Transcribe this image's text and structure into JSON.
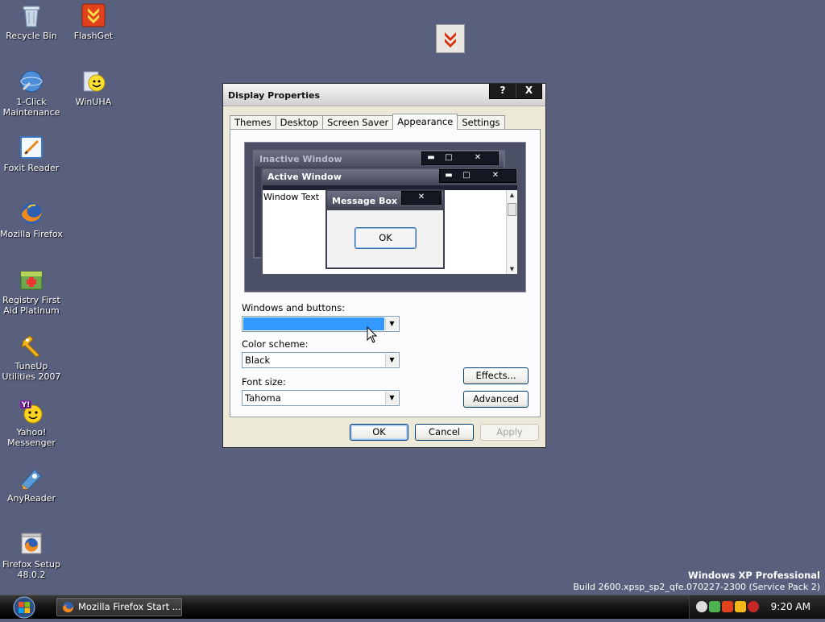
{
  "desktop": {
    "icons": [
      {
        "label": "Recycle Bin",
        "icon": "recycle-bin-icon"
      },
      {
        "label": "FlashGet",
        "icon": "flashget-icon"
      },
      {
        "label": "1-Click Maintenance",
        "icon": "maintenance-icon"
      },
      {
        "label": "WinUHA",
        "icon": "winuha-icon"
      },
      {
        "label": "Foxit Reader",
        "icon": "foxit-reader-icon"
      },
      {
        "label": "Mozilla Firefox",
        "icon": "firefox-icon"
      },
      {
        "label": "Registry First Aid Platinum",
        "icon": "registry-first-aid-icon"
      },
      {
        "label": "TuneUp Utilities 2007",
        "icon": "tuneup-icon"
      },
      {
        "label": "Yahoo! Messenger",
        "icon": "yahoo-messenger-icon"
      },
      {
        "label": "AnyReader",
        "icon": "anyreader-icon"
      },
      {
        "label": "Firefox Setup 48.0.2",
        "icon": "firefox-setup-icon"
      }
    ]
  },
  "dialog": {
    "title": "Display Properties",
    "help_button": "?",
    "close_button": "X",
    "tabs": [
      {
        "label": "Themes"
      },
      {
        "label": "Desktop"
      },
      {
        "label": "Screen Saver"
      },
      {
        "label": "Appearance",
        "active": true
      },
      {
        "label": "Settings"
      }
    ],
    "preview": {
      "inactive_title": "Inactive Window",
      "active_title": "Active Window",
      "window_text": "Window Text",
      "message_box_title": "Message Box",
      "message_box_ok": "OK"
    },
    "windows_and_buttons": {
      "label": "Windows and buttons:",
      "value": ""
    },
    "color_scheme": {
      "label": "Color scheme:",
      "value": "Black"
    },
    "font_size": {
      "label": "Font size:",
      "value": "Tahoma"
    },
    "effects_button": "Effects...",
    "advanced_button": "Advanced",
    "ok_button": "OK",
    "cancel_button": "Cancel",
    "apply_button": "Apply"
  },
  "watermark": {
    "line1": "Windows XP Professional",
    "line2": "Build 2600.xpsp_sp2_qfe.070227-2300 (Service Pack 2)"
  },
  "taskbar": {
    "task_label": "Mozilla Firefox Start ...",
    "clock": "9:20 AM"
  },
  "colors": {
    "desktop_bg": "#59607e",
    "selection": "#3399ff"
  }
}
